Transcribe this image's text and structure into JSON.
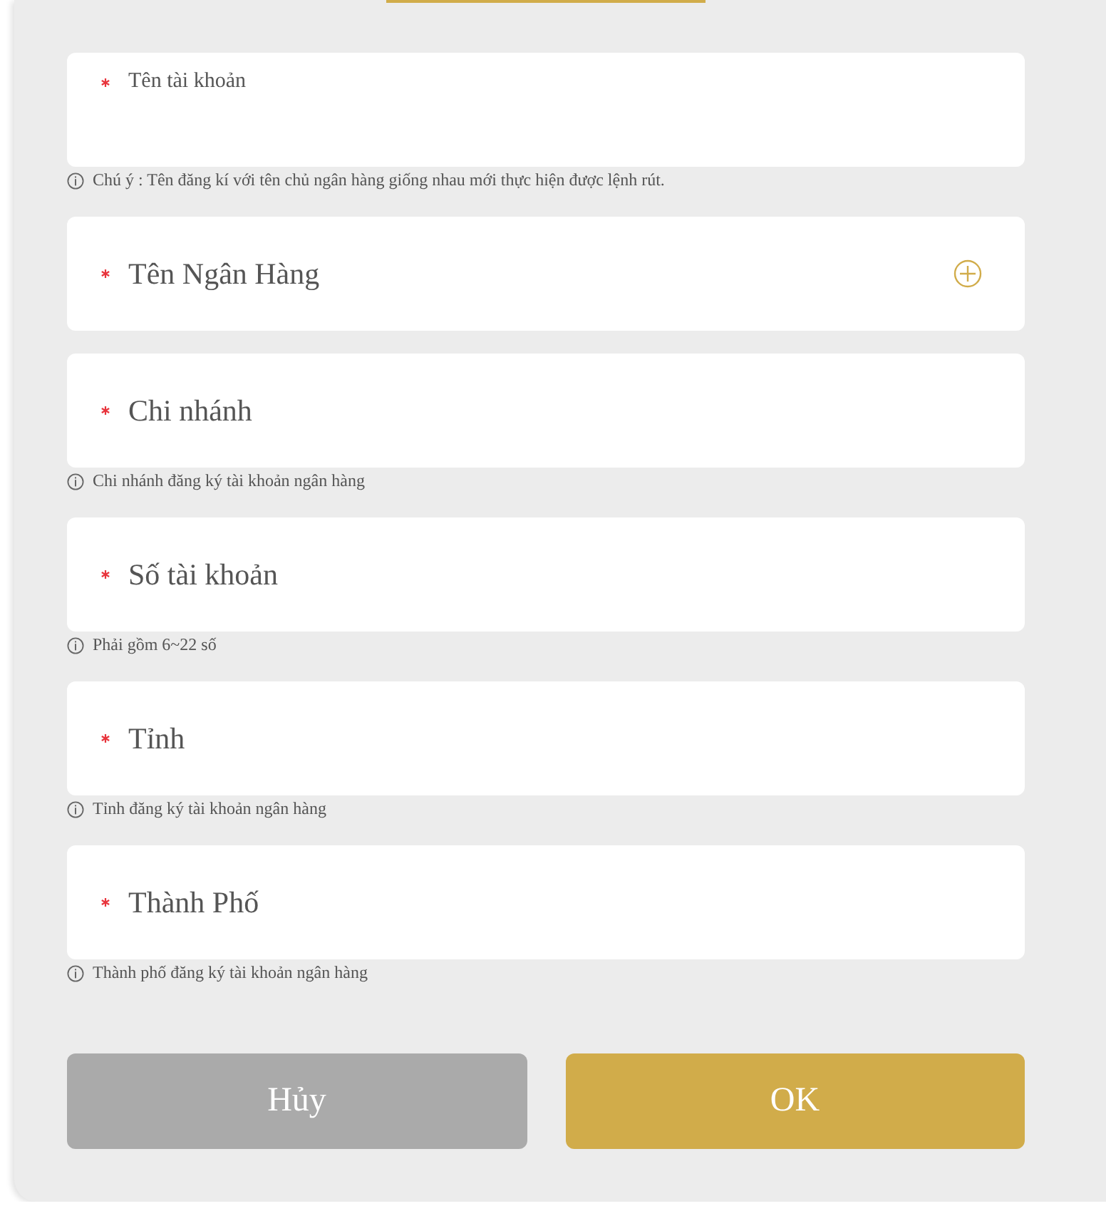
{
  "fields": [
    {
      "label": "Tên tài khoản",
      "required": true,
      "floated": true,
      "kind": "text",
      "hint": "Chú ý : Tên đăng kí với tên chủ ngân hàng giống nhau mới thực hiện được lệnh rút."
    },
    {
      "label": "Tên Ngân Hàng",
      "required": true,
      "floated": false,
      "kind": "picker"
    },
    {
      "label": "Chi nhánh",
      "required": true,
      "floated": false,
      "kind": "text",
      "hint": "Chi nhánh đăng ký tài khoản ngân hàng"
    },
    {
      "label": "Số tài khoản",
      "required": true,
      "floated": false,
      "kind": "text",
      "hint": "Phải gồm 6~22 số"
    },
    {
      "label": "Tỉnh",
      "required": true,
      "floated": false,
      "kind": "text",
      "hint": "Tỉnh đăng ký tài khoản ngân hàng"
    },
    {
      "label": "Thành Phố",
      "required": true,
      "floated": false,
      "kind": "text",
      "hint": "Thành phố đăng ký tài khoản ngân hàng"
    }
  ],
  "buttons": [
    {
      "label": "Hủy",
      "kind": "cancel"
    },
    {
      "label": "OK",
      "kind": "confirm"
    }
  ]
}
